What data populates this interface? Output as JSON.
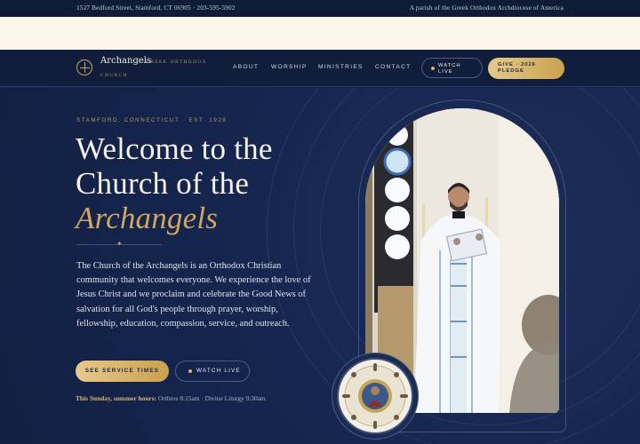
{
  "topbar": {
    "address": "1527 Bedford Street, Stamford, CT 06905 · 203-595-5902",
    "parish": "A parish of the Greek Orthodox Archdiocese of America"
  },
  "nav": {
    "brand": "Archangels",
    "brand_sub_1": "GREEK ORTHODOX",
    "brand_sub_2": "CHURCH",
    "links": [
      "ABOUT",
      "WORSHIP",
      "MINISTRIES",
      "CONTACT"
    ],
    "watch_live": "WATCH LIVE",
    "give": "GIVE · 2026 PLEDGE"
  },
  "hero": {
    "eyebrow": "STAMFORD, CONNECTICUT · EST. 1928",
    "title_line1": "Welcome to the",
    "title_line2": "Church of the",
    "title_line3": "Archangels",
    "description": "The Church of the Archangels is an Orthodox Christian community that welcomes everyone. We experience the love of Jesus Christ and we proclaim and celebrate the Good News of salvation for all God's people through prayer, worship, fellowship, education, compassion, service, and outreach.",
    "service_button": "SEE SERVICE TIMES",
    "watch_button": "WATCH LIVE",
    "hours_label": "This Sunday, summer hours:",
    "hours_value": "Orthros 8:15am · Divine Liturgy 9:30am"
  },
  "colors": {
    "navy": "#142448",
    "gold": "#c9a55c",
    "cream": "#fbf7ea"
  }
}
